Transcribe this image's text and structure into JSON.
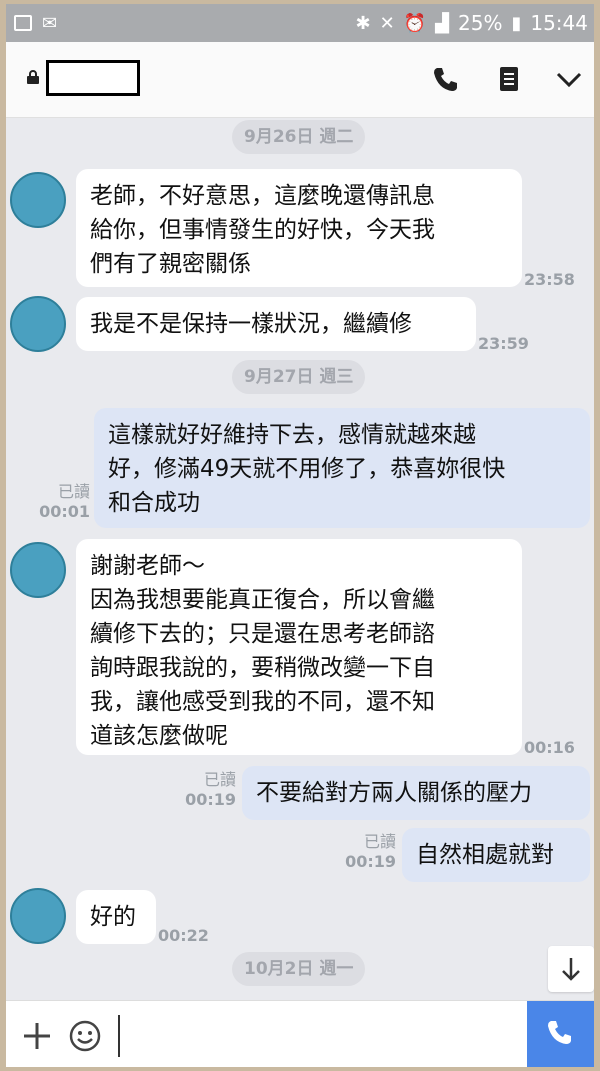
{
  "status_bar": {
    "battery": "25%",
    "time": "15:44"
  },
  "header": {
    "contact_name": ""
  },
  "chat": {
    "dates": [
      "9月26日 週二",
      "9月27日 週三",
      "10月2日 週一"
    ],
    "messages": [
      {
        "side": "in",
        "text": "老師，不好意思，這麼晚還傳訊息\n給你，但事情發生的好快，今天我\n們有了親密關係",
        "time": "23:58"
      },
      {
        "side": "in",
        "text": "我是不是保持一樣狀況，繼續修",
        "time": "23:59"
      },
      {
        "side": "out",
        "text": "這樣就好好維持下去，感情就越來越\n好，修滿49天就不用修了，恭喜妳很快\n和合成功",
        "read": "已讀",
        "time": "00:01"
      },
      {
        "side": "in",
        "text": "謝謝老師～\n因為我想要能真正復合，所以會繼\n續修下去的；只是還在思考老師諮\n詢時跟我說的，要稍微改變一下自\n我，讓他感受到我的不同，還不知\n道該怎麼做呢",
        "time": "00:16"
      },
      {
        "side": "out",
        "text": "不要給對方兩人關係的壓力",
        "read": "已讀",
        "time": "00:19"
      },
      {
        "side": "out",
        "text": "自然相處就對",
        "read": "已讀",
        "time": "00:19"
      },
      {
        "side": "in",
        "text": "好的",
        "time": "00:22"
      }
    ]
  },
  "colors": {
    "call_button": "#4a86e8",
    "outgoing_bubble": "#dde5f5",
    "avatar": "#4aa0c0"
  },
  "icons": [
    "lock-icon",
    "phone-icon",
    "memo-icon",
    "chevron-down-icon",
    "arrow-down-icon",
    "plus-icon",
    "emoji-icon",
    "call-icon"
  ]
}
